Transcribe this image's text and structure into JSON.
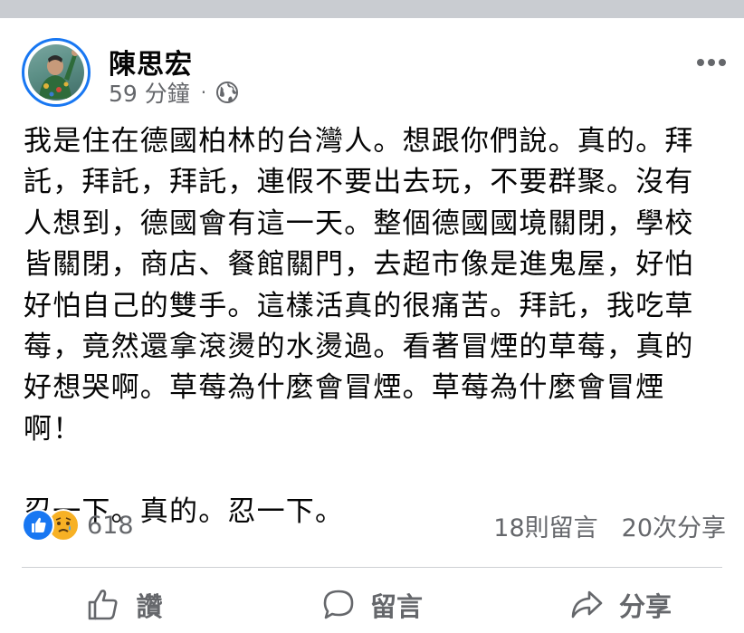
{
  "post": {
    "author": "陳思宏",
    "time": "59 分鐘",
    "separator": "·",
    "privacy_icon": "globe-icon",
    "more_icon": "more-dots-icon",
    "body": "我是住在德國柏林的台灣人。想跟你們說。真的。拜託，拜託，拜託，連假不要出去玩，不要群聚。沒有人想到，德國會有這一天。整個德國國境關閉，學校皆關閉，商店、餐館關門，去超市像是進鬼屋，好怕好怕自己的雙手。這樣活真的很痛苦。拜託，我吃草莓，竟然還拿滾燙的水燙過。看著冒煙的草莓，真的好想哭啊。草莓為什麼會冒煙。草莓為什麼會冒煙啊！\n\n忍一下。真的。忍一下。"
  },
  "engagement": {
    "reaction_icons": [
      "like-icon",
      "sad-icon"
    ],
    "reaction_count": "618",
    "comments": "18則留言",
    "shares": "20次分享"
  },
  "actions": {
    "like_label": "讚",
    "comment_label": "留言",
    "share_label": "分享"
  },
  "colors": {
    "accent": "#1877f2",
    "secondary_text": "#65676b",
    "sad_reaction": "#f7b125",
    "top_bar": "#c9ccd1"
  }
}
